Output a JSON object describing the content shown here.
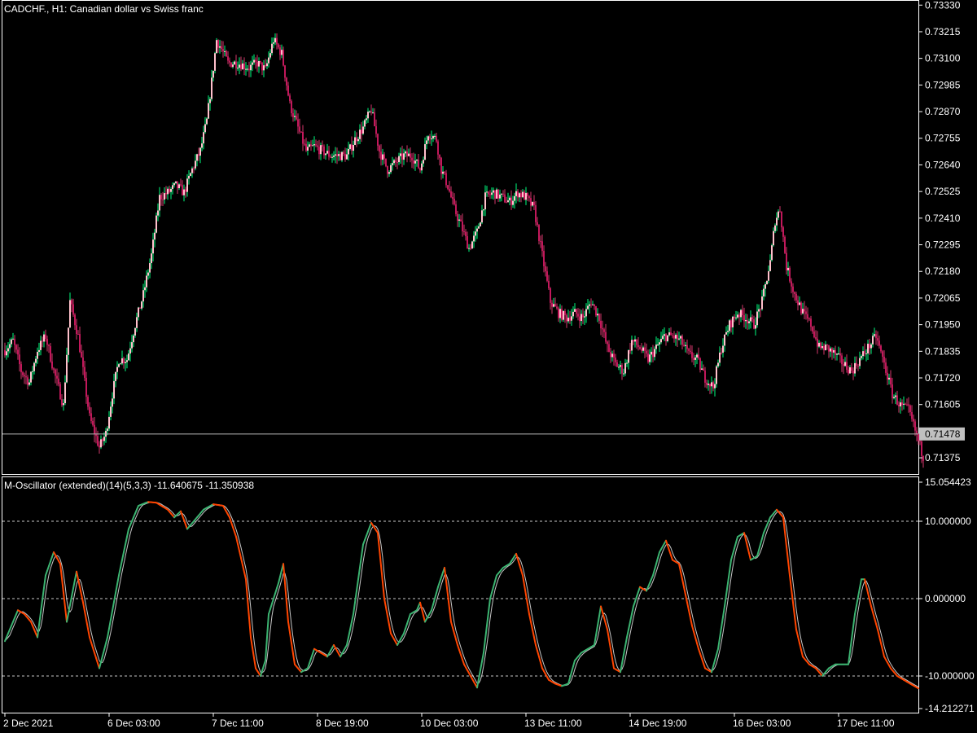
{
  "chart_data": [
    {
      "type": "candlestick",
      "title": "CADCHF., H1:  Canadian dollar vs Swiss franc",
      "yticks": [
        "0.73330",
        "0.73215",
        "0.73100",
        "0.72985",
        "0.72870",
        "0.72755",
        "0.72640",
        "0.72525",
        "0.72410",
        "0.72295",
        "0.72180",
        "0.72065",
        "0.71950",
        "0.71835",
        "0.71720",
        "0.71605",
        "0.71375"
      ],
      "ylim": [
        0.71305,
        0.73345
      ],
      "current_price": "0.71478",
      "current_price_value": 0.71478,
      "colors": {
        "bull": "#00ff7f",
        "bear": "#d3386d",
        "bull_body": "#ffc0cb",
        "bear_body": "#c2185b",
        "price_line": "#b4b4b4",
        "price_label_bg": "#c0c0c0"
      },
      "keypoints": [
        [
          0,
          0.7184
        ],
        [
          5,
          0.7188
        ],
        [
          10,
          0.7175
        ],
        [
          15,
          0.717
        ],
        [
          20,
          0.7184
        ],
        [
          25,
          0.719
        ],
        [
          30,
          0.7175
        ],
        [
          36,
          0.716
        ],
        [
          40,
          0.7205
        ],
        [
          45,
          0.719
        ],
        [
          52,
          0.7155
        ],
        [
          58,
          0.7142
        ],
        [
          62,
          0.7148
        ],
        [
          66,
          0.7165
        ],
        [
          70,
          0.718
        ],
        [
          75,
          0.718
        ],
        [
          80,
          0.7195
        ],
        [
          85,
          0.7208
        ],
        [
          90,
          0.7225
        ],
        [
          95,
          0.725
        ],
        [
          100,
          0.7252
        ],
        [
          105,
          0.7255
        ],
        [
          110,
          0.7252
        ],
        [
          115,
          0.7262
        ],
        [
          120,
          0.727
        ],
        [
          124,
          0.7283
        ],
        [
          127,
          0.73
        ],
        [
          130,
          0.7318
        ],
        [
          133,
          0.7314
        ],
        [
          137,
          0.7308
        ],
        [
          143,
          0.7308
        ],
        [
          150,
          0.7306
        ],
        [
          155,
          0.7308
        ],
        [
          160,
          0.7305
        ],
        [
          165,
          0.7318
        ],
        [
          170,
          0.7312
        ],
        [
          175,
          0.729
        ],
        [
          180,
          0.728
        ],
        [
          185,
          0.727
        ],
        [
          190,
          0.7272
        ],
        [
          195,
          0.727
        ],
        [
          200,
          0.7268
        ],
        [
          210,
          0.7268
        ],
        [
          215,
          0.7275
        ],
        [
          220,
          0.728
        ],
        [
          225,
          0.7288
        ],
        [
          230,
          0.727
        ],
        [
          235,
          0.7262
        ],
        [
          240,
          0.7265
        ],
        [
          245,
          0.7268
        ],
        [
          250,
          0.7268
        ],
        [
          255,
          0.7262
        ],
        [
          260,
          0.7278
        ],
        [
          265,
          0.7275
        ],
        [
          268,
          0.7262
        ],
        [
          272,
          0.7255
        ],
        [
          276,
          0.7245
        ],
        [
          280,
          0.7238
        ],
        [
          285,
          0.7228
        ],
        [
          290,
          0.7235
        ],
        [
          295,
          0.725
        ],
        [
          300,
          0.7252
        ],
        [
          305,
          0.725
        ],
        [
          310,
          0.7248
        ],
        [
          315,
          0.7252
        ],
        [
          320,
          0.725
        ],
        [
          325,
          0.7245
        ],
        [
          330,
          0.7225
        ],
        [
          335,
          0.7205
        ],
        [
          340,
          0.72
        ],
        [
          345,
          0.7198
        ],
        [
          350,
          0.72
        ],
        [
          355,
          0.7198
        ],
        [
          360,
          0.7205
        ],
        [
          365,
          0.7198
        ],
        [
          370,
          0.7185
        ],
        [
          375,
          0.7178
        ],
        [
          380,
          0.7175
        ],
        [
          385,
          0.7188
        ],
        [
          390,
          0.7185
        ],
        [
          395,
          0.718
        ],
        [
          400,
          0.7185
        ],
        [
          405,
          0.719
        ],
        [
          410,
          0.719
        ],
        [
          415,
          0.7188
        ],
        [
          420,
          0.7182
        ],
        [
          425,
          0.718
        ],
        [
          430,
          0.7172
        ],
        [
          435,
          0.7168
        ],
        [
          440,
          0.7185
        ],
        [
          445,
          0.7195
        ],
        [
          450,
          0.72
        ],
        [
          455,
          0.7198
        ],
        [
          460,
          0.7195
        ],
        [
          465,
          0.7205
        ],
        [
          470,
          0.7222
        ],
        [
          473,
          0.724
        ],
        [
          476,
          0.7245
        ],
        [
          480,
          0.722
        ],
        [
          485,
          0.7208
        ],
        [
          490,
          0.72
        ],
        [
          495,
          0.7195
        ],
        [
          500,
          0.7185
        ],
        [
          505,
          0.7185
        ],
        [
          510,
          0.7182
        ],
        [
          515,
          0.7178
        ],
        [
          520,
          0.7175
        ],
        [
          525,
          0.718
        ],
        [
          530,
          0.7185
        ],
        [
          535,
          0.719
        ],
        [
          540,
          0.7178
        ],
        [
          545,
          0.7165
        ],
        [
          550,
          0.716
        ],
        [
          555,
          0.7158
        ],
        [
          560,
          0.7147
        ],
        [
          564,
          0.7138
        ]
      ]
    },
    {
      "type": "line",
      "title": "M-Oscillator (extended)(14)(5,3,3) -11.640675 -11.350938",
      "yticks": [
        "15.054423",
        "10.000000",
        "0.000000",
        "-10.000000",
        "-14.212271"
      ],
      "dashed_levels": [
        10,
        0,
        -10
      ],
      "ylim": [
        -14.212271,
        15.054423
      ],
      "colors": {
        "main_up": "#3cb371",
        "main_down": "#ff4500",
        "signal": "#c8c8c8"
      },
      "keypoints": [
        [
          0,
          -5.5
        ],
        [
          8,
          -1.5
        ],
        [
          12,
          -2.0
        ],
        [
          16,
          -3.0
        ],
        [
          20,
          -5.0
        ],
        [
          25,
          3.0
        ],
        [
          30,
          6.0
        ],
        [
          34,
          4.5
        ],
        [
          38,
          -3.0
        ],
        [
          44,
          3.5
        ],
        [
          48,
          -0.5
        ],
        [
          52,
          -5.0
        ],
        [
          58,
          -9.0
        ],
        [
          63,
          -5.0
        ],
        [
          70,
          3.0
        ],
        [
          76,
          9.0
        ],
        [
          82,
          12.0
        ],
        [
          88,
          12.5
        ],
        [
          93,
          12.4
        ],
        [
          100,
          11.5
        ],
        [
          104,
          10.5
        ],
        [
          108,
          11.3
        ],
        [
          112,
          9.0
        ],
        [
          116,
          10.0
        ],
        [
          122,
          11.5
        ],
        [
          128,
          12.2
        ],
        [
          134,
          12.0
        ],
        [
          138,
          10.5
        ],
        [
          142,
          8.0
        ],
        [
          148,
          2.5
        ],
        [
          151,
          -5.0
        ],
        [
          154,
          -9.0
        ],
        [
          157,
          -10.0
        ],
        [
          160,
          -8.0
        ],
        [
          162,
          -2.0
        ],
        [
          168,
          2.0
        ],
        [
          171,
          4.5
        ],
        [
          174,
          -3.0
        ],
        [
          178,
          -8.5
        ],
        [
          182,
          -9.5
        ],
        [
          186,
          -9.0
        ],
        [
          190,
          -6.5
        ],
        [
          194,
          -7.0
        ],
        [
          198,
          -7.5
        ],
        [
          202,
          -6.0
        ],
        [
          206,
          -7.5
        ],
        [
          210,
          -6.0
        ],
        [
          214,
          -2.0
        ],
        [
          220,
          7.0
        ],
        [
          225,
          9.8
        ],
        [
          229,
          8.5
        ],
        [
          233,
          0.0
        ],
        [
          237,
          -4.5
        ],
        [
          241,
          -6.0
        ],
        [
          245,
          -4.5
        ],
        [
          249,
          -2.0
        ],
        [
          253,
          -1.5
        ],
        [
          255,
          -0.5
        ],
        [
          258,
          -3.0
        ],
        [
          262,
          -1.5
        ],
        [
          266,
          1.5
        ],
        [
          270,
          4.0
        ],
        [
          274,
          -3.0
        ],
        [
          278,
          -6.0
        ],
        [
          282,
          -8.5
        ],
        [
          286,
          -10.0
        ],
        [
          290,
          -11.5
        ],
        [
          294,
          -7.0
        ],
        [
          298,
          0.0
        ],
        [
          302,
          3.0
        ],
        [
          306,
          4.0
        ],
        [
          310,
          4.5
        ],
        [
          314,
          5.8
        ],
        [
          318,
          3.0
        ],
        [
          322,
          -2.0
        ],
        [
          326,
          -6.0
        ],
        [
          330,
          -9.0
        ],
        [
          334,
          -10.5
        ],
        [
          338,
          -11.0
        ],
        [
          342,
          -11.3
        ],
        [
          346,
          -11.0
        ],
        [
          350,
          -8.0
        ],
        [
          354,
          -7.0
        ],
        [
          358,
          -6.5
        ],
        [
          362,
          -6.0
        ],
        [
          366,
          -1.0
        ],
        [
          370,
          -4.0
        ],
        [
          374,
          -9.0
        ],
        [
          378,
          -9.5
        ],
        [
          382,
          -5.0
        ],
        [
          386,
          -1.0
        ],
        [
          390,
          1.5
        ],
        [
          394,
          1.0
        ],
        [
          398,
          3.0
        ],
        [
          402,
          6.0
        ],
        [
          406,
          7.5
        ],
        [
          410,
          5.0
        ],
        [
          414,
          4.5
        ],
        [
          418,
          0.5
        ],
        [
          422,
          -3.5
        ],
        [
          426,
          -6.5
        ],
        [
          430,
          -9.0
        ],
        [
          434,
          -9.5
        ],
        [
          438,
          -6.5
        ],
        [
          442,
          -1.0
        ],
        [
          446,
          5.0
        ],
        [
          450,
          8.0
        ],
        [
          454,
          8.5
        ],
        [
          458,
          5.0
        ],
        [
          462,
          5.5
        ],
        [
          466,
          8.5
        ],
        [
          470,
          10.5
        ],
        [
          474,
          11.5
        ],
        [
          478,
          10.5
        ],
        [
          482,
          3.0
        ],
        [
          486,
          -4.0
        ],
        [
          490,
          -7.5
        ],
        [
          494,
          -8.5
        ],
        [
          498,
          -9.0
        ],
        [
          502,
          -10.0
        ],
        [
          506,
          -9.0
        ],
        [
          510,
          -8.5
        ],
        [
          514,
          -8.5
        ],
        [
          518,
          -8.5
        ],
        [
          522,
          -2.0
        ],
        [
          526,
          2.5
        ],
        [
          528,
          2.5
        ],
        [
          532,
          -1.0
        ],
        [
          536,
          -4.0
        ],
        [
          540,
          -7.5
        ],
        [
          544,
          -9.0
        ],
        [
          548,
          -10.0
        ],
        [
          552,
          -10.5
        ],
        [
          556,
          -11.0
        ],
        [
          561,
          -11.6
        ]
      ]
    }
  ],
  "x_axis": {
    "labels": [
      {
        "text": "2 Dec 2021",
        "bar": 0
      },
      {
        "text": "6 Dec 03:00",
        "bar": 64
      },
      {
        "text": "7 Dec 11:00",
        "bar": 128
      },
      {
        "text": "8 Dec 19:00",
        "bar": 192
      },
      {
        "text": "10 Dec 03:00",
        "bar": 256
      },
      {
        "text": "13 Dec 11:00",
        "bar": 320
      },
      {
        "text": "14 Dec 19:00",
        "bar": 384
      },
      {
        "text": "16 Dec 03:00",
        "bar": 448
      },
      {
        "text": "17 Dec 11:00",
        "bar": 512
      }
    ],
    "bar_count": 565
  }
}
